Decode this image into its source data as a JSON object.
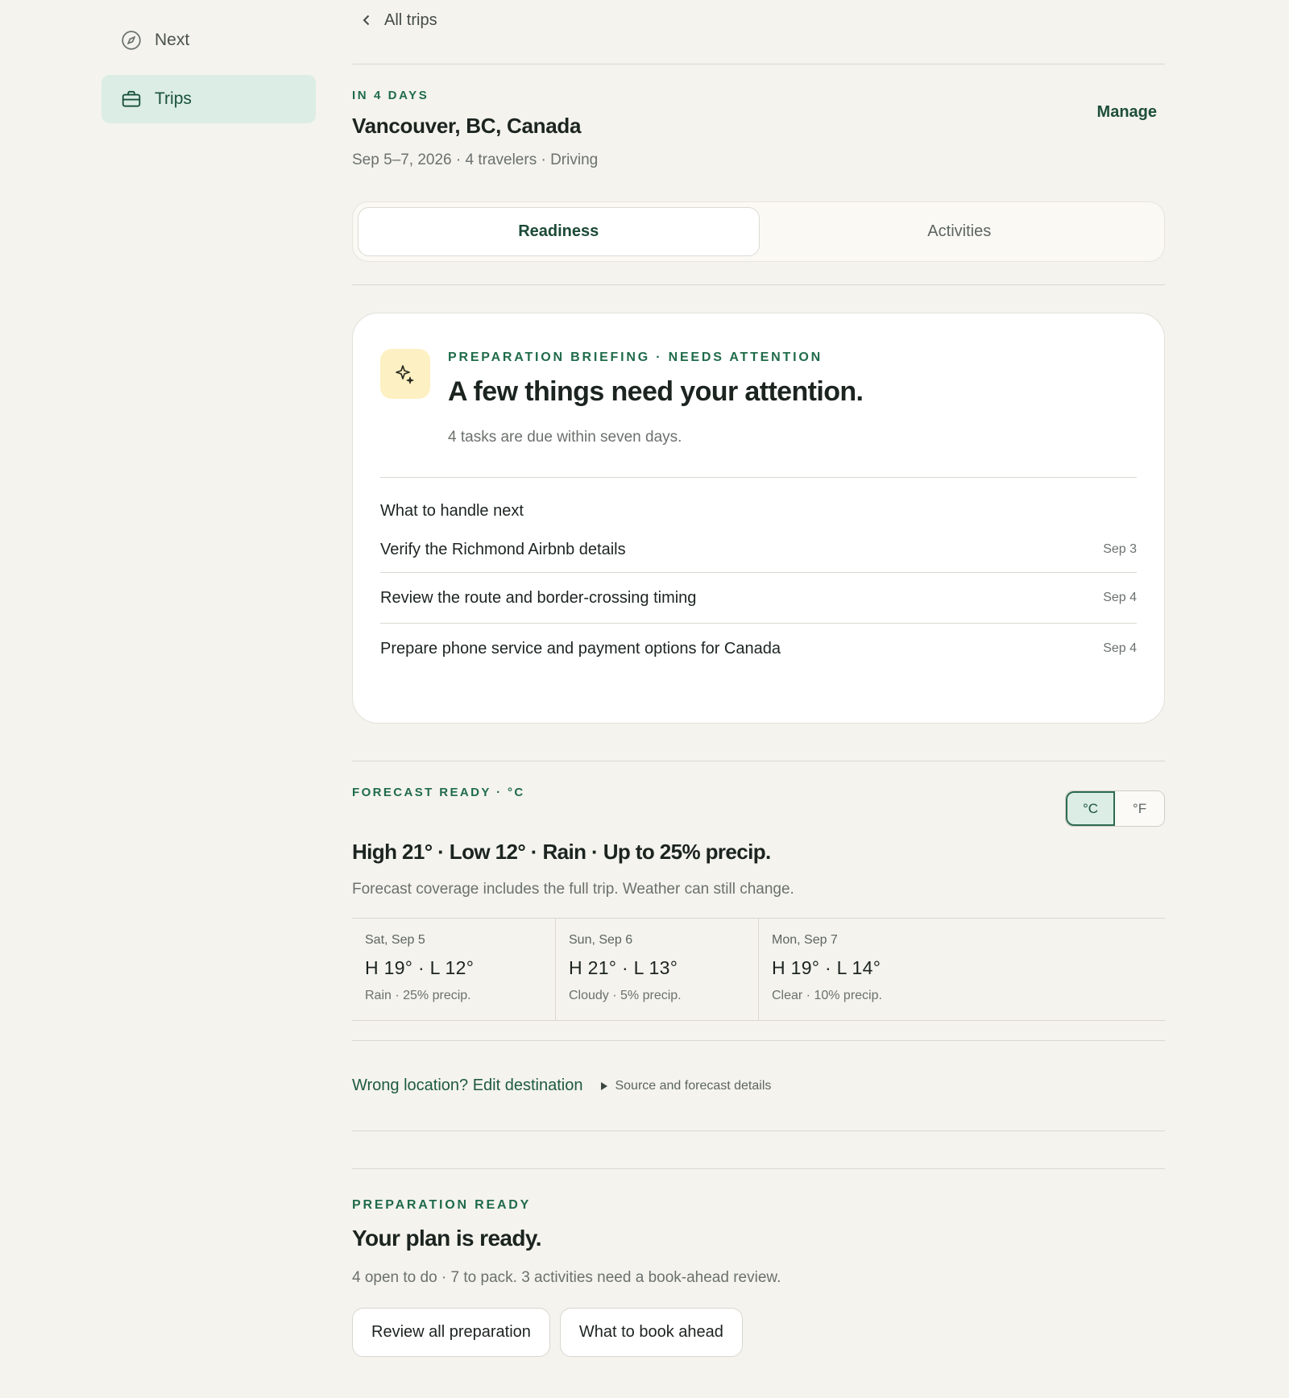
{
  "sidebar": {
    "items": [
      {
        "label": "Next",
        "icon": "compass-icon",
        "active": false
      },
      {
        "label": "Trips",
        "icon": "briefcase-icon",
        "active": true
      }
    ]
  },
  "header": {
    "back_label": "All trips"
  },
  "trip": {
    "eyebrow": "IN 4 DAYS",
    "title": "Vancouver, BC, Canada",
    "meta": "Sep 5–7, 2026 · 4 travelers · Driving",
    "manage_label": "Manage"
  },
  "tabs": [
    {
      "label": "Readiness",
      "active": true
    },
    {
      "label": "Activities",
      "active": false
    }
  ],
  "briefing": {
    "icon": "sparkle-icon",
    "eyebrow": "PREPARATION BRIEFING · NEEDS ATTENTION",
    "title": "A few things need your attention.",
    "subtitle": "4 tasks are due within seven days.",
    "next_heading": "What to handle next",
    "tasks": [
      {
        "label": "Verify the Richmond Airbnb details",
        "date": "Sep 3"
      },
      {
        "label": "Review the route and border-crossing timing",
        "date": "Sep 4"
      },
      {
        "label": "Prepare phone service and payment options for Canada",
        "date": "Sep 4"
      }
    ]
  },
  "forecast": {
    "eyebrow": "FORECAST READY · °C",
    "units": [
      {
        "label": "°C",
        "active": true
      },
      {
        "label": "°F",
        "active": false
      }
    ],
    "summary": "High 21° · Low 12° · Rain · Up to 25% precip.",
    "note": "Forecast coverage includes the full trip. Weather can still change.",
    "days": [
      {
        "name": "Sat, Sep 5",
        "temp": "H 19° · L 12°",
        "condition": "Rain · 25% precip."
      },
      {
        "name": "Sun, Sep 6",
        "temp": "H 21° · L 13°",
        "condition": "Cloudy · 5% precip."
      },
      {
        "name": "Mon, Sep 7",
        "temp": "H 19° · L 14°",
        "condition": "Clear · 10% precip."
      }
    ],
    "edit_link": "Wrong location? Edit destination",
    "details_label": "Source and forecast details"
  },
  "preparation": {
    "eyebrow": "PREPARATION READY",
    "title": "Your plan is ready.",
    "subtitle": "4 open to do · 7 to pack. 3 activities need a book-ahead review.",
    "buttons": [
      {
        "label": "Review all preparation"
      },
      {
        "label": "What to book ahead"
      }
    ]
  },
  "colors": {
    "accent": "#1f6b49",
    "background": "#f4f3ee",
    "active_nav": "#dcede5",
    "sparkle_badge": "#fdf0c2"
  }
}
